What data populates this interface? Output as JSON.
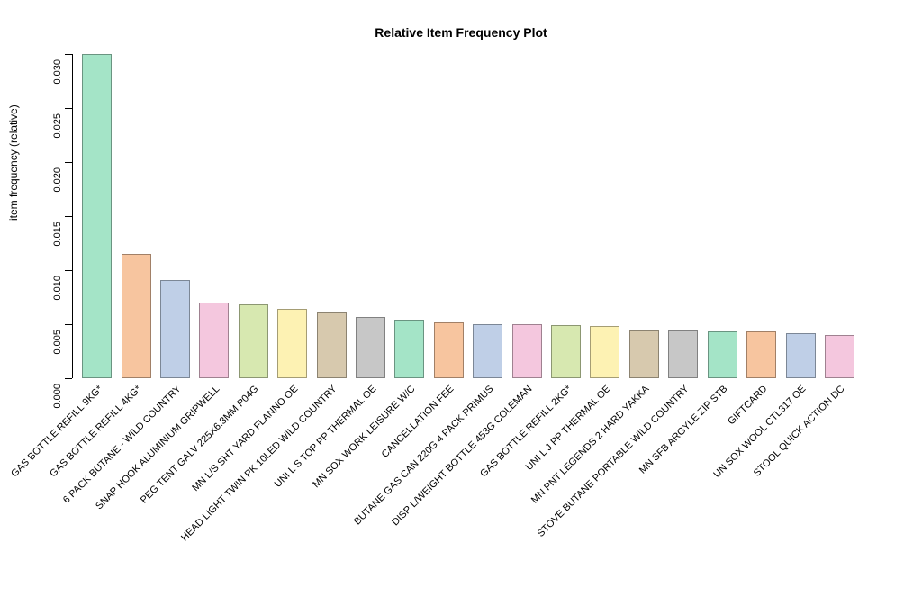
{
  "chart_data": {
    "type": "bar",
    "title": "Relative Item Frequency Plot",
    "xlabel": "",
    "ylabel": "item frequency (relative)",
    "ylim": [
      0,
      0.03
    ],
    "yticks": [
      0.0,
      0.005,
      0.01,
      0.015,
      0.02,
      0.025,
      0.03
    ],
    "ytick_labels": [
      "0.000",
      "0.005",
      "0.010",
      "0.015",
      "0.020",
      "0.025",
      "0.030"
    ],
    "colors": [
      "#A4E4C7",
      "#F7C59F",
      "#BFCFE7",
      "#F4C7DE",
      "#D7E8B0",
      "#FDF2B3",
      "#D7C9AE",
      "#C7C7C7",
      "#A4E4C7",
      "#F7C59F",
      "#BFCFE7",
      "#F4C7DE",
      "#D7E8B0",
      "#FDF2B3",
      "#D7C9AE",
      "#C7C7C7",
      "#A4E4C7",
      "#F7C59F",
      "#BFCFE7",
      "#F4C7DE"
    ],
    "categories": [
      "GAS BOTTLE REFILL 9KG*",
      "GAS BOTTLE REFILL 4KG*",
      "6 PACK BUTANE - WILD COUNTRY",
      "SNAP HOOK ALUMINIUM GRIPWELL",
      "PEG TENT GALV 225X6.3MM P04G",
      "MN L/S SHT YARD FLANNO OE",
      "HEAD LIGHT TWIN PK 10LED WILD COUNTRY",
      "UNI L S TOP PP THERMAL OE",
      "MN SOX WORK LEISURE W/C",
      "CANCELLATION FEE",
      "BUTANE GAS CAN 220G 4 PACK PRIMUS",
      "DISP L/WEIGHT BOTTLE 453G COLEMAN",
      "GAS BOTTLE REFILL 2KG*",
      "UNI L J PP THERMAL OE",
      "MN PNT LEGENDS 2 HARD YAKKA",
      "STOVE BUTANE PORTABLE WILD COUNTRY",
      "MN SFB ARGYLE ZIP STB",
      "GIFTCARD",
      "UN SOX WOOL CTL317 OE",
      "STOOL QUICK ACTION DC"
    ],
    "values": [
      0.03,
      0.0115,
      0.0091,
      0.007,
      0.0068,
      0.0064,
      0.0061,
      0.0057,
      0.0054,
      0.0052,
      0.005,
      0.005,
      0.0049,
      0.0048,
      0.0044,
      0.0044,
      0.0043,
      0.0043,
      0.0042,
      0.004
    ]
  }
}
